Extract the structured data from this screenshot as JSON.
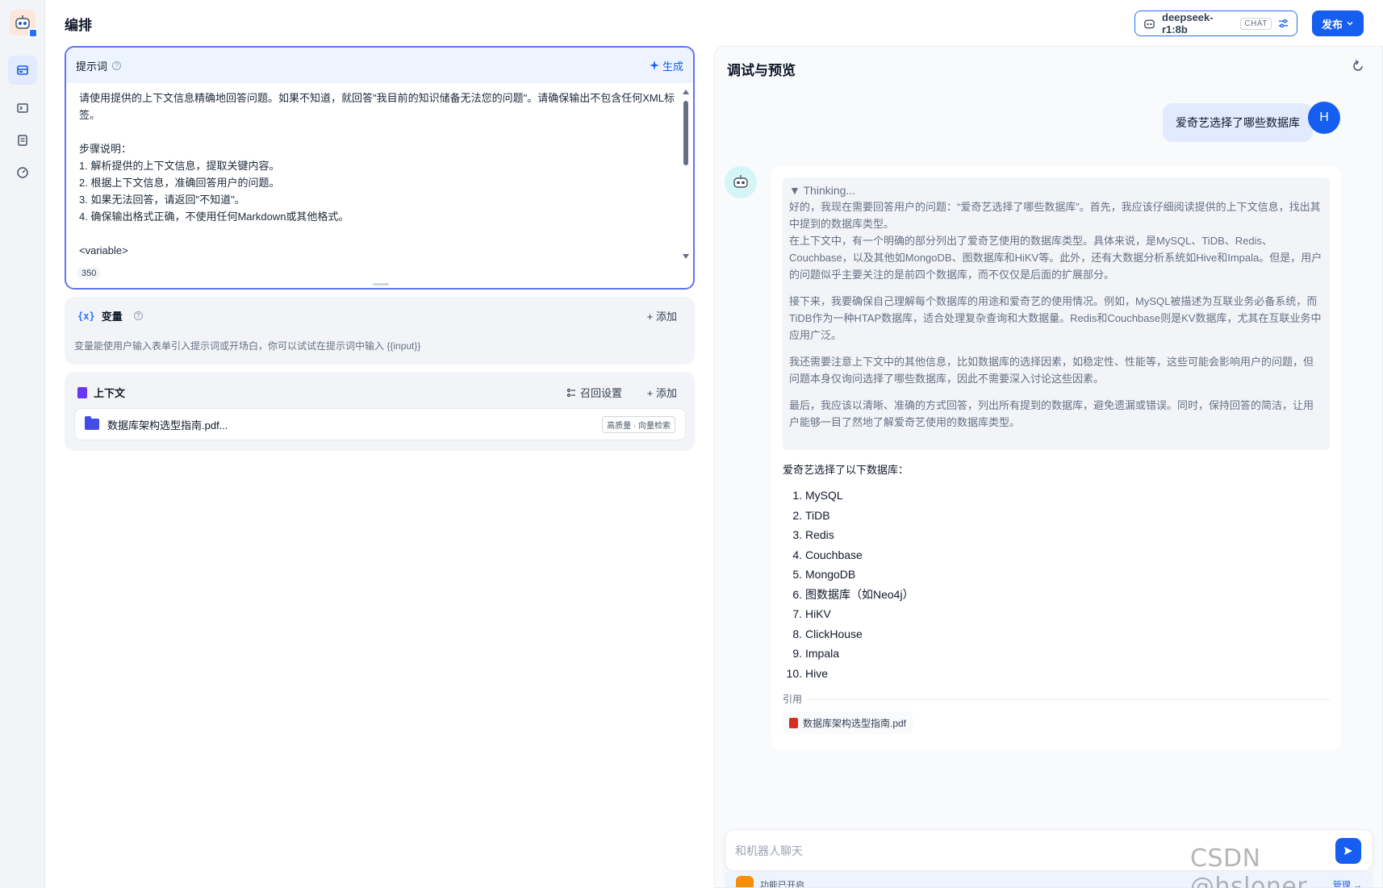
{
  "nav": {
    "items": [
      {
        "name": "orchestrate",
        "icon": "layout-icon",
        "active": true
      },
      {
        "name": "api",
        "icon": "terminal-icon",
        "active": false
      },
      {
        "name": "logs",
        "icon": "document-list-icon",
        "active": false
      },
      {
        "name": "monitoring",
        "icon": "gauge-icon",
        "active": false
      }
    ]
  },
  "header": {
    "title": "编排",
    "model_name": "deepseek-r1:8b",
    "model_tag": "CHAT",
    "publish_label": "发布"
  },
  "prompt": {
    "label": "提示词",
    "generate_label": "生成",
    "text": "请使用提供的上下文信息精确地回答问题。如果不知道，就回答\"我目前的知识储备无法您的问题\"。请确保输出不包含任何XML标签。\n\n步骤说明：\n1. 解析提供的上下文信息，提取关键内容。\n2. 根据上下文信息，准确回答用户的问题。\n3. 如果无法回答，请返回\"不知道\"。\n4. 确保输出格式正确，不使用任何Markdown或其他格式。\n\n<variable>\n{{context}}\n</variable>",
    "char_count": "350"
  },
  "variables": {
    "symbol": "{x}",
    "label": "变量",
    "add_label": "+ 添加",
    "description": "变量能使用户输入表单引入提示词或开场白，你可以试试在提示词中输入 {{input}}"
  },
  "context": {
    "label": "上下文",
    "recall_label": "召回设置",
    "add_label": "+ 添加",
    "dataset_name": "数据库架构选型指南.pdf...",
    "dataset_tag": "高质量 · 向量检索"
  },
  "debug": {
    "title": "调试与预览",
    "user_avatar": "H",
    "user_message": "爱奇艺选择了哪些数据库",
    "thinking_title": "▼ Thinking...",
    "thinking_paragraphs": [
      "好的，我现在需要回答用户的问题：“爱奇艺选择了哪些数据库”。首先，我应该仔细阅读提供的上下文信息，找出其中提到的数据库类型。\n在上下文中，有一个明确的部分列出了爱奇艺使用的数据库类型。具体来说，是MySQL、TiDB、Redis、Couchbase，以及其他如MongoDB、图数据库和HiKV等。此外，还有大数据分析系统如Hive和Impala。但是，用户的问题似乎主要关注的是前四个数据库，而不仅仅是后面的扩展部分。",
      "接下来，我要确保自己理解每个数据库的用途和爱奇艺的使用情况。例如，MySQL被描述为互联业务必备系统，而TiDB作为一种HTAP数据库，适合处理复杂查询和大数据量。Redis和Couchbase则是KV数据库，尤其在互联业务中应用广泛。",
      "我还需要注意上下文中的其他信息，比如数据库的选择因素，如稳定性、性能等，这些可能会影响用户的问题，但问题本身仅询问选择了哪些数据库，因此不需要深入讨论这些因素。",
      "最后，我应该以清晰、准确的方式回答，列出所有提到的数据库，避免遗漏或错误。同时，保持回答的简洁，让用户能够一目了然地了解爱奇艺使用的数据库类型。"
    ],
    "answer_intro": "爱奇艺选择了以下数据库：",
    "answer_list": [
      "MySQL",
      "TiDB",
      "Redis",
      "Couchbase",
      "MongoDB",
      "图数据库（如Neo4j）",
      "HiKV",
      "ClickHouse",
      "Impala",
      "Hive"
    ],
    "citation_label": "引用",
    "citation_file": "数据库架构选型指南.pdf",
    "input_placeholder": "和机器人聊天",
    "feature_text": "功能已开启",
    "manage_label": "管理 →"
  },
  "watermark": "CSDN @hsloner",
  "colors": {
    "accent": "#155eef",
    "prompt_border": "#6172f3",
    "user_bubble": "#e1eaff"
  }
}
